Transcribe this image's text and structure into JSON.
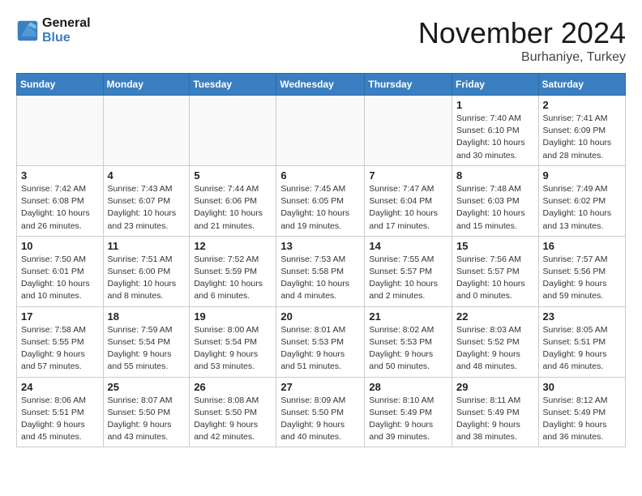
{
  "header": {
    "logo_line1": "General",
    "logo_line2": "Blue",
    "month": "November 2024",
    "location": "Burhaniye, Turkey"
  },
  "weekdays": [
    "Sunday",
    "Monday",
    "Tuesday",
    "Wednesday",
    "Thursday",
    "Friday",
    "Saturday"
  ],
  "weeks": [
    [
      {
        "day": "",
        "info": ""
      },
      {
        "day": "",
        "info": ""
      },
      {
        "day": "",
        "info": ""
      },
      {
        "day": "",
        "info": ""
      },
      {
        "day": "",
        "info": ""
      },
      {
        "day": "1",
        "info": "Sunrise: 7:40 AM\nSunset: 6:10 PM\nDaylight: 10 hours and 30 minutes."
      },
      {
        "day": "2",
        "info": "Sunrise: 7:41 AM\nSunset: 6:09 PM\nDaylight: 10 hours and 28 minutes."
      }
    ],
    [
      {
        "day": "3",
        "info": "Sunrise: 7:42 AM\nSunset: 6:08 PM\nDaylight: 10 hours and 26 minutes."
      },
      {
        "day": "4",
        "info": "Sunrise: 7:43 AM\nSunset: 6:07 PM\nDaylight: 10 hours and 23 minutes."
      },
      {
        "day": "5",
        "info": "Sunrise: 7:44 AM\nSunset: 6:06 PM\nDaylight: 10 hours and 21 minutes."
      },
      {
        "day": "6",
        "info": "Sunrise: 7:45 AM\nSunset: 6:05 PM\nDaylight: 10 hours and 19 minutes."
      },
      {
        "day": "7",
        "info": "Sunrise: 7:47 AM\nSunset: 6:04 PM\nDaylight: 10 hours and 17 minutes."
      },
      {
        "day": "8",
        "info": "Sunrise: 7:48 AM\nSunset: 6:03 PM\nDaylight: 10 hours and 15 minutes."
      },
      {
        "day": "9",
        "info": "Sunrise: 7:49 AM\nSunset: 6:02 PM\nDaylight: 10 hours and 13 minutes."
      }
    ],
    [
      {
        "day": "10",
        "info": "Sunrise: 7:50 AM\nSunset: 6:01 PM\nDaylight: 10 hours and 10 minutes."
      },
      {
        "day": "11",
        "info": "Sunrise: 7:51 AM\nSunset: 6:00 PM\nDaylight: 10 hours and 8 minutes."
      },
      {
        "day": "12",
        "info": "Sunrise: 7:52 AM\nSunset: 5:59 PM\nDaylight: 10 hours and 6 minutes."
      },
      {
        "day": "13",
        "info": "Sunrise: 7:53 AM\nSunset: 5:58 PM\nDaylight: 10 hours and 4 minutes."
      },
      {
        "day": "14",
        "info": "Sunrise: 7:55 AM\nSunset: 5:57 PM\nDaylight: 10 hours and 2 minutes."
      },
      {
        "day": "15",
        "info": "Sunrise: 7:56 AM\nSunset: 5:57 PM\nDaylight: 10 hours and 0 minutes."
      },
      {
        "day": "16",
        "info": "Sunrise: 7:57 AM\nSunset: 5:56 PM\nDaylight: 9 hours and 59 minutes."
      }
    ],
    [
      {
        "day": "17",
        "info": "Sunrise: 7:58 AM\nSunset: 5:55 PM\nDaylight: 9 hours and 57 minutes."
      },
      {
        "day": "18",
        "info": "Sunrise: 7:59 AM\nSunset: 5:54 PM\nDaylight: 9 hours and 55 minutes."
      },
      {
        "day": "19",
        "info": "Sunrise: 8:00 AM\nSunset: 5:54 PM\nDaylight: 9 hours and 53 minutes."
      },
      {
        "day": "20",
        "info": "Sunrise: 8:01 AM\nSunset: 5:53 PM\nDaylight: 9 hours and 51 minutes."
      },
      {
        "day": "21",
        "info": "Sunrise: 8:02 AM\nSunset: 5:53 PM\nDaylight: 9 hours and 50 minutes."
      },
      {
        "day": "22",
        "info": "Sunrise: 8:03 AM\nSunset: 5:52 PM\nDaylight: 9 hours and 48 minutes."
      },
      {
        "day": "23",
        "info": "Sunrise: 8:05 AM\nSunset: 5:51 PM\nDaylight: 9 hours and 46 minutes."
      }
    ],
    [
      {
        "day": "24",
        "info": "Sunrise: 8:06 AM\nSunset: 5:51 PM\nDaylight: 9 hours and 45 minutes."
      },
      {
        "day": "25",
        "info": "Sunrise: 8:07 AM\nSunset: 5:50 PM\nDaylight: 9 hours and 43 minutes."
      },
      {
        "day": "26",
        "info": "Sunrise: 8:08 AM\nSunset: 5:50 PM\nDaylight: 9 hours and 42 minutes."
      },
      {
        "day": "27",
        "info": "Sunrise: 8:09 AM\nSunset: 5:50 PM\nDaylight: 9 hours and 40 minutes."
      },
      {
        "day": "28",
        "info": "Sunrise: 8:10 AM\nSunset: 5:49 PM\nDaylight: 9 hours and 39 minutes."
      },
      {
        "day": "29",
        "info": "Sunrise: 8:11 AM\nSunset: 5:49 PM\nDaylight: 9 hours and 38 minutes."
      },
      {
        "day": "30",
        "info": "Sunrise: 8:12 AM\nSunset: 5:49 PM\nDaylight: 9 hours and 36 minutes."
      }
    ]
  ]
}
